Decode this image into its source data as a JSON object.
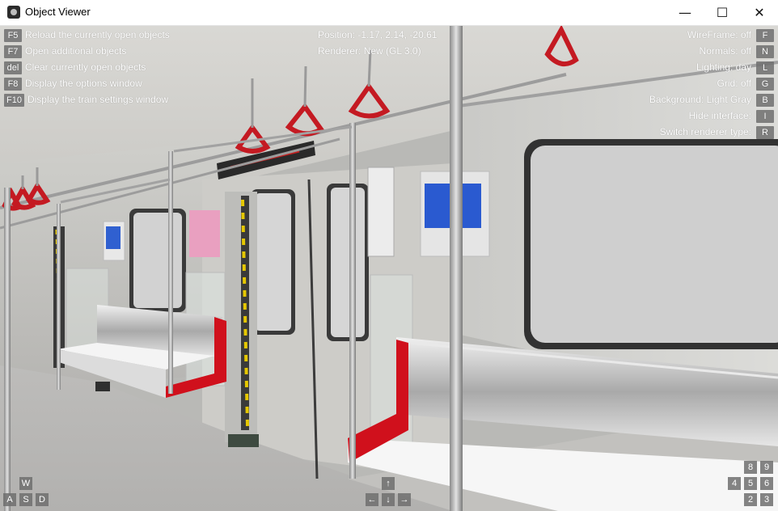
{
  "window": {
    "title": "Object Viewer",
    "minimize_glyph": "—",
    "maximize_glyph": "☐",
    "close_glyph": "✕"
  },
  "hud_left": [
    {
      "key": "F5",
      "label": "Reload the currently open objects"
    },
    {
      "key": "F7",
      "label": "Open additional objects"
    },
    {
      "key": "del",
      "label": "Clear currently open objects"
    },
    {
      "key": "F8",
      "label": "Display the options window"
    },
    {
      "key": "F10",
      "label": "Display the train settings window"
    }
  ],
  "hud_center": {
    "position": "Position: -1.17, 2.14, -20.61",
    "renderer": "Renderer: New (GL 3.0)"
  },
  "hud_right": [
    {
      "label": "WireFrame: off",
      "key": "F"
    },
    {
      "label": "Normals: off",
      "key": "N"
    },
    {
      "label": "Lighting: day",
      "key": "L"
    },
    {
      "label": "Grid: off",
      "key": "G"
    },
    {
      "label": "Background: Light Gray",
      "key": "B"
    },
    {
      "label": "Hide interface:",
      "key": "I"
    },
    {
      "label": "Switch renderer type:",
      "key": "R"
    }
  ],
  "movement_keys": {
    "w": "W",
    "a": "A",
    "s": "S",
    "d": "D"
  },
  "arrow_keys": {
    "up": "↑",
    "left": "←",
    "down": "↓",
    "right": "→"
  },
  "numpad_keys": {
    "k8": "8",
    "k9": "9",
    "k4": "4",
    "k5": "5",
    "k6": "6",
    "k2": "2",
    "k3": "3"
  },
  "colors": {
    "seat_trim": "#d0101c",
    "handle": "#c41a22",
    "wall": "#d8d8d4",
    "floor": "#b7b6b4"
  }
}
